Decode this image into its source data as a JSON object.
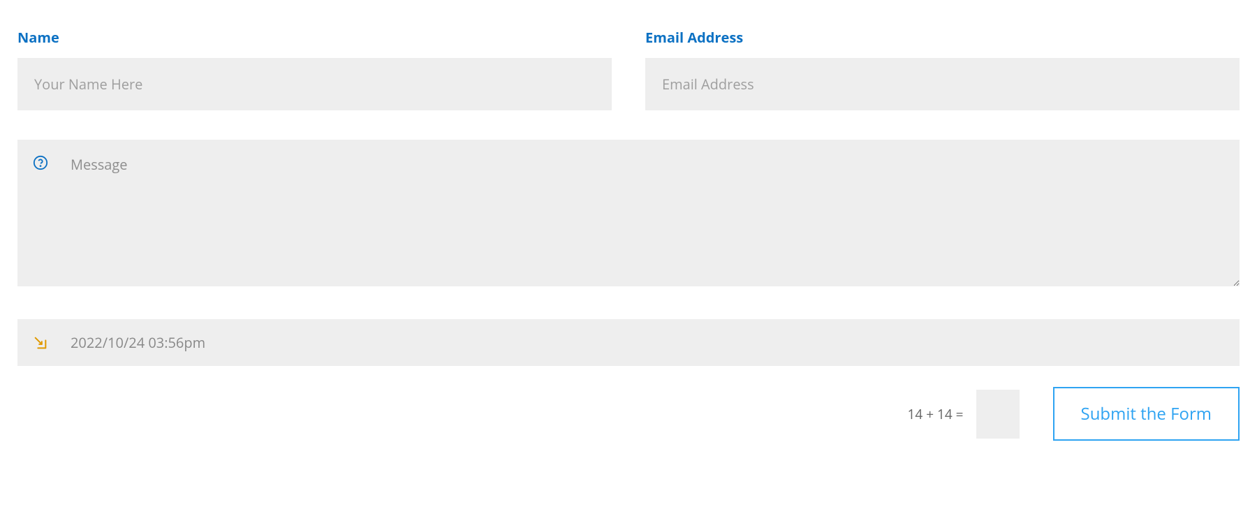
{
  "form": {
    "name": {
      "label": "Name",
      "placeholder": "Your Name Here",
      "value": ""
    },
    "email": {
      "label": "Email Address",
      "placeholder": "Email Address",
      "value": ""
    },
    "message": {
      "placeholder": "Message",
      "value": ""
    },
    "datetime": {
      "value": "2022/10/24 03:56pm"
    },
    "captcha": {
      "question": "14 + 14 =",
      "value": ""
    },
    "submit": {
      "label": "Submit the Form"
    }
  }
}
